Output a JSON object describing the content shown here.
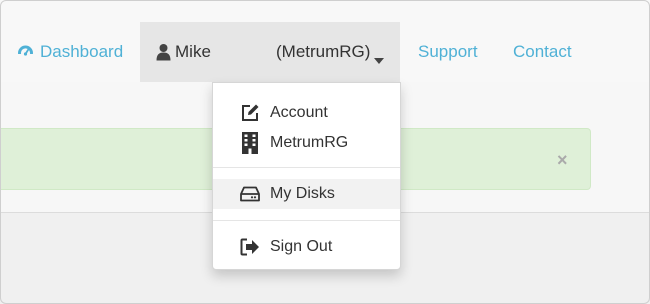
{
  "nav": {
    "dashboard": {
      "label": "Dashboard",
      "icon": "dashboard-icon"
    },
    "user": {
      "name": "Mike",
      "org": "(MetrumRG)",
      "icon": "user-icon",
      "caret": "caret-down-icon"
    },
    "support": {
      "label": "Support"
    },
    "contact": {
      "label": "Contact"
    }
  },
  "dropdown": {
    "items": [
      {
        "label": "Account",
        "icon": "edit-icon"
      },
      {
        "label": "MetrumRG",
        "icon": "building-icon"
      },
      {
        "label": "My Disks",
        "icon": "hard-drive-icon",
        "active": true
      },
      {
        "label": "Sign Out",
        "icon": "sign-out-icon"
      }
    ]
  },
  "alert": {
    "close_label": "×"
  },
  "colors": {
    "link": "#4fb1d6",
    "alert_bg": "#dff0d8",
    "menu_bg": "#e6e6e6"
  }
}
